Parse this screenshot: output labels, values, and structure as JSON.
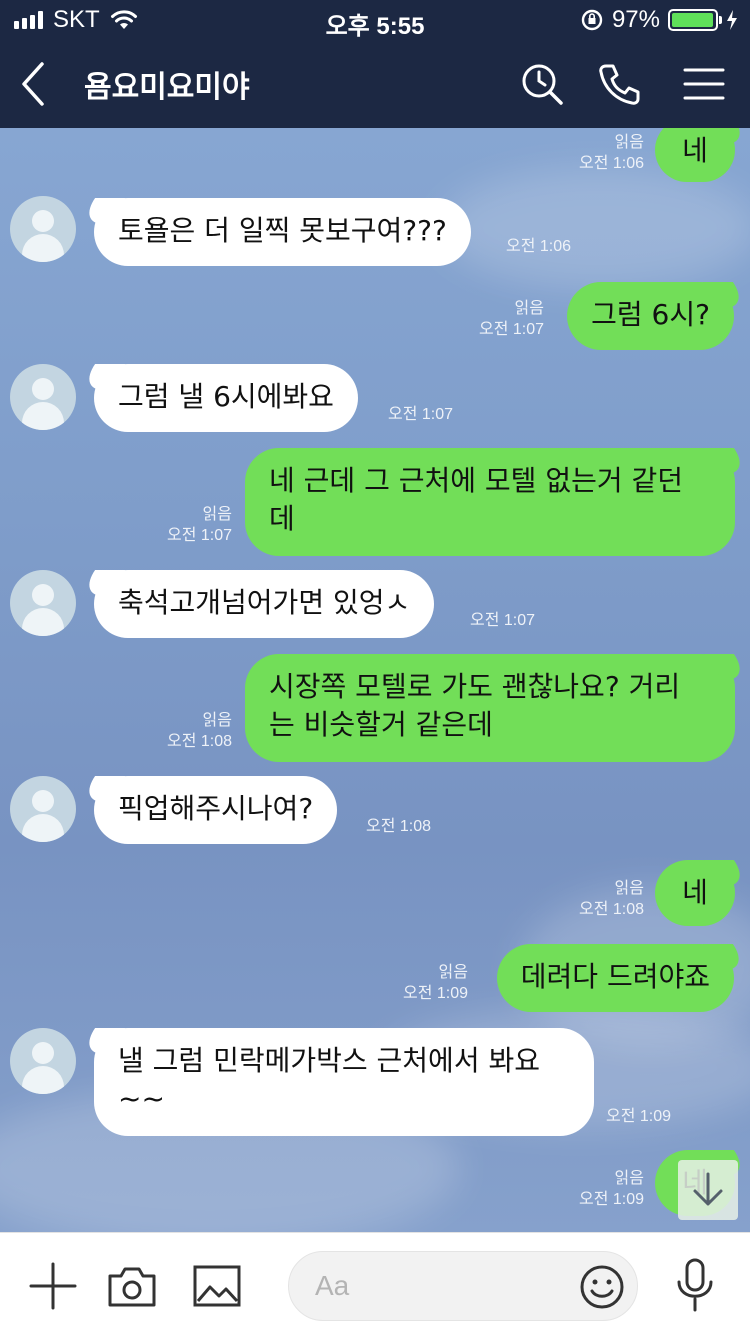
{
  "status_bar": {
    "carrier": "SKT",
    "time": "오후 5:55",
    "battery": "97%",
    "battery_level": 0.97
  },
  "header": {
    "title": "욤요미요미야",
    "icons": [
      "back-icon",
      "search-clock-icon",
      "phone-icon",
      "menu-icon"
    ]
  },
  "messages": [
    {
      "side": "out",
      "text": "네",
      "read": "읽음",
      "time": "오전 1:06"
    },
    {
      "side": "in",
      "text": "토욜은 더 일찍 못보구여???",
      "time": "오전 1:06"
    },
    {
      "side": "out",
      "text": "그럼 6시?",
      "read": "읽음",
      "time": "오전 1:07"
    },
    {
      "side": "in",
      "text": "그럼 낼 6시에봐요",
      "time": "오전 1:07"
    },
    {
      "side": "out",
      "text": "네 근데 그 근처에 모텔 없는거 같던\n데",
      "read": "읽음",
      "time": "오전 1:07"
    },
    {
      "side": "in",
      "text": "축석고개넘어가면 있엉ㅅ",
      "time": "오전 1:07"
    },
    {
      "side": "out",
      "text": "시장쪽 모텔로 가도 괜찮나요? 거리\n는 비슷할거 같은데",
      "read": "읽음",
      "time": "오전 1:08"
    },
    {
      "side": "in",
      "text": "픽업해주시나여?",
      "time": "오전 1:08"
    },
    {
      "side": "out",
      "text": "네",
      "read": "읽음",
      "time": "오전 1:08"
    },
    {
      "side": "out",
      "text": "데려다 드려야죠",
      "read": "읽음",
      "time": "오전 1:09"
    },
    {
      "side": "in",
      "text": "낼 그럼 민락메가박스 근처에서 봐요\n~~",
      "time": "오전 1:09"
    },
    {
      "side": "out",
      "text": "네",
      "read": "읽음",
      "time": "오전 1:09"
    }
  ],
  "input_bar": {
    "placeholder": "Aa",
    "icons": [
      "plus-icon",
      "camera-icon",
      "image-icon",
      "emoji-icon",
      "microphone-icon"
    ]
  },
  "colors": {
    "header_bg": "#1c2843",
    "incoming_bubble": "#ffffff",
    "outgoing_bubble": "#72de58",
    "chat_bg": "#809ecb"
  }
}
